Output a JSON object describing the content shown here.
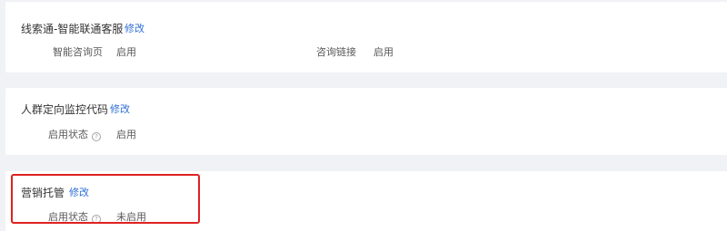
{
  "sections": [
    {
      "title": "线索通-智能联通客服",
      "edit_label": "修改",
      "fields": [
        {
          "label": "智能咨询页",
          "value": "启用"
        },
        {
          "label": "咨询链接",
          "value": "启用"
        }
      ]
    },
    {
      "title": "人群定向监控代码",
      "edit_label": "修改",
      "fields": [
        {
          "label": "启用状态",
          "value": "启用",
          "help_icon": "question-circle-icon"
        }
      ]
    },
    {
      "title": "营销托管",
      "edit_label": "修改",
      "fields": [
        {
          "label": "启用状态",
          "value": "未启用",
          "help_icon": "question-circle-icon"
        }
      ]
    }
  ],
  "help_icon_glyph": "?",
  "colors": {
    "background": "#f0f2f5",
    "card": "#ffffff",
    "link": "#2f6fd6",
    "highlight": "#e02020"
  }
}
